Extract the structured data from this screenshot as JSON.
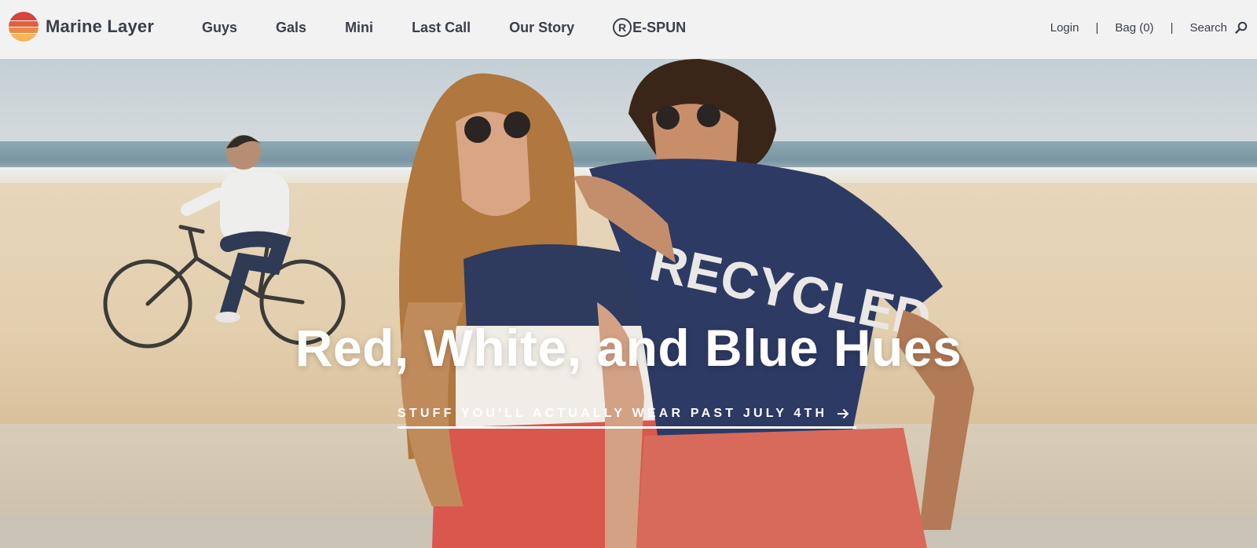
{
  "brand": {
    "name": "Marine Layer",
    "logo_colors": [
      "#d6443d",
      "#e1603e",
      "#e98a4c",
      "#f2b85b"
    ]
  },
  "nav": {
    "items": [
      "Guys",
      "Gals",
      "Mini",
      "Last Call",
      "Our Story"
    ],
    "respun_mark": "R",
    "respun_label": "E-SPUN"
  },
  "utility": {
    "login": "Login",
    "separator": "|",
    "bag": "Bag (0)",
    "search": "Search",
    "search_icon": "search-icon"
  },
  "hero": {
    "title": "Red, White, and Blue Hues",
    "cta_label": "STUFF YOU'LL ACTUALLY WEAR PAST JULY 4TH",
    "cta_icon": "arrow-right-icon",
    "shirt_text": "RECYCLED"
  },
  "colors": {
    "text": "#3a3f4b",
    "header_bg": "#f2f2f2",
    "hero_text": "#ffffff"
  }
}
